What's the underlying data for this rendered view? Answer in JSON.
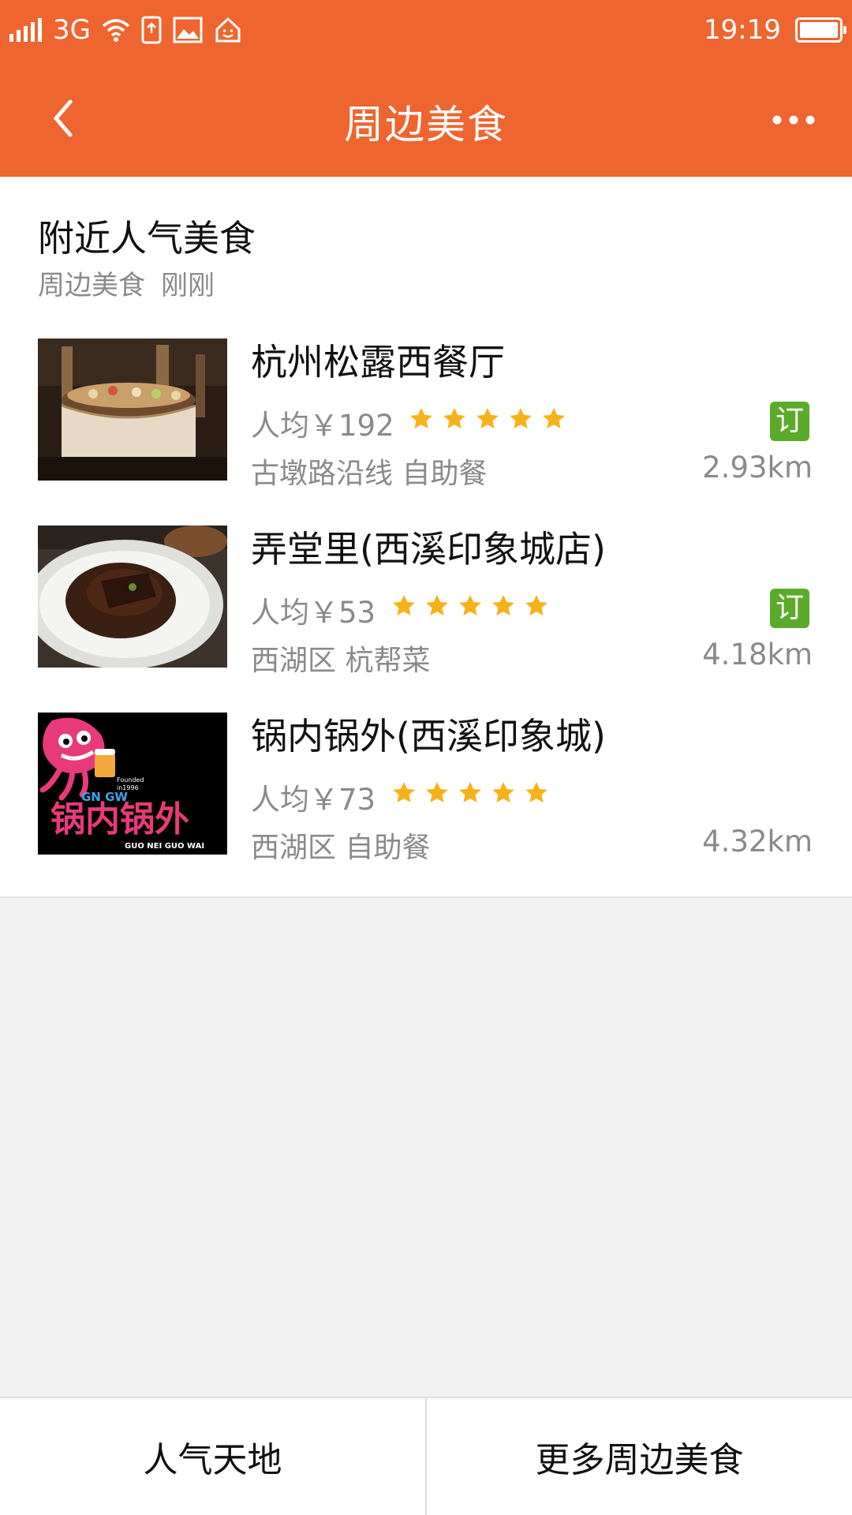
{
  "status_bar": {
    "network": "3G",
    "time": "19:19"
  },
  "header": {
    "title": "周边美食",
    "back_icon": "chevron-left-icon",
    "more_icon": "more-dots-icon",
    "background_color": "#ee6530"
  },
  "section": {
    "title": "附近人气美食",
    "subtitle_source": "周边美食",
    "subtitle_time": "刚刚"
  },
  "restaurants": [
    {
      "name": "杭州松露西餐厅",
      "price": "人均￥192",
      "rating": 5,
      "bookable": true,
      "order_label": "订",
      "tags": "古墩路沿线 自助餐",
      "distance": "2.93km"
    },
    {
      "name": "弄堂里(西溪印象城店)",
      "price": "人均￥53",
      "rating": 5,
      "bookable": true,
      "order_label": "订",
      "tags": "西湖区 杭帮菜",
      "distance": "4.18km"
    },
    {
      "name": "锅内锅外(西溪印象城)",
      "price": "人均￥73",
      "rating": 5,
      "bookable": false,
      "tags": "西湖区 自助餐",
      "distance": "4.32km",
      "logo_text": {
        "top": "GN GW",
        "founded": "Founded",
        "year": "in1996",
        "main": "锅内锅外",
        "roman": "GUO NEI GUO WAI"
      }
    }
  ],
  "colors": {
    "accent": "#ee6530",
    "star": "#f7b21a",
    "badge_green": "#5bab2a"
  },
  "bottom_bar": {
    "left_label": "人气天地",
    "right_label": "更多周边美食"
  }
}
